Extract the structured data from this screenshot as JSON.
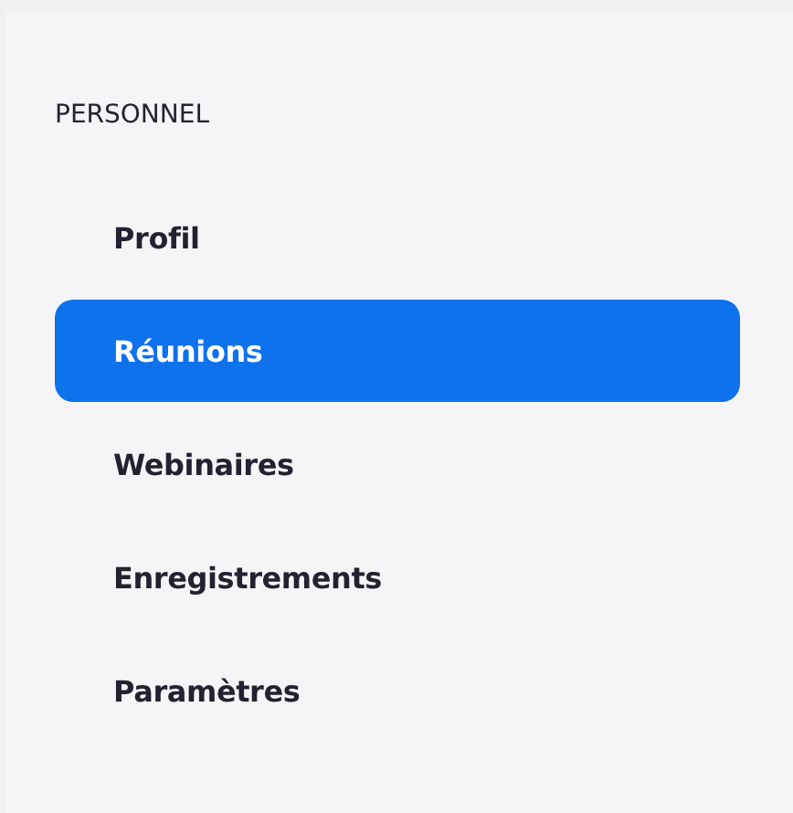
{
  "sidebar": {
    "section_title": "PERSONNEL",
    "items": [
      {
        "label": "Profil",
        "selected": false
      },
      {
        "label": "Réunions",
        "selected": true
      },
      {
        "label": "Webinaires",
        "selected": false
      },
      {
        "label": "Enregistrements",
        "selected": false
      },
      {
        "label": "Paramètres",
        "selected": false
      }
    ]
  }
}
